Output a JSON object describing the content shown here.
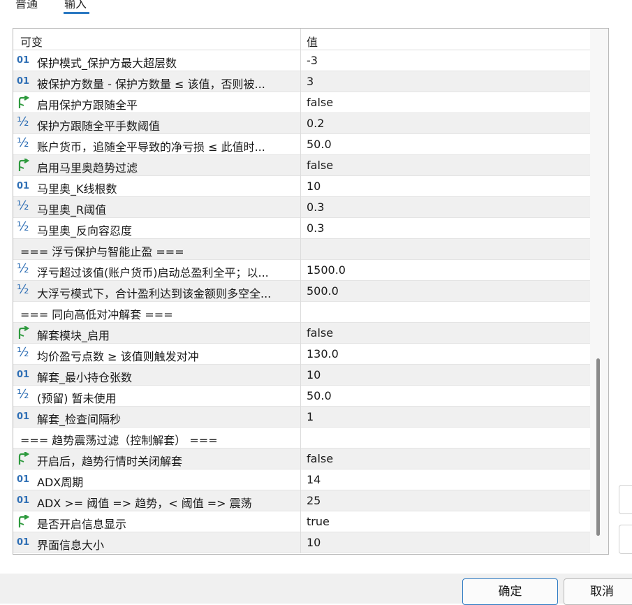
{
  "tabs": [
    {
      "label": "普通"
    },
    {
      "label": "输入"
    }
  ],
  "table": {
    "col_variable": "可变",
    "col_value": "值",
    "rows": [
      {
        "icon": "int",
        "icon_text": "01",
        "name": "保护模式_保护方最大超层数",
        "value": "-3"
      },
      {
        "icon": "int",
        "icon_text": "01",
        "name": "被保护方数量 - 保护方数量 ≤ 该值，否则被...",
        "value": "3"
      },
      {
        "icon": "bool",
        "name": "启用保护方跟随全平",
        "value": "false"
      },
      {
        "icon": "double",
        "icon_text": "½",
        "name": "保护方跟随全平手数阈值",
        "value": "0.2"
      },
      {
        "icon": "double",
        "icon_text": "½",
        "name": "账户货币，追随全平导致的净亏损 ≤ 此值时...",
        "value": "50.0"
      },
      {
        "icon": "bool",
        "name": "启用马里奥趋势过滤",
        "value": "false"
      },
      {
        "icon": "int",
        "icon_text": "01",
        "name": "马里奥_K线根数",
        "value": "10"
      },
      {
        "icon": "double",
        "icon_text": "½",
        "name": "马里奥_R阈值",
        "value": "0.3"
      },
      {
        "icon": "double",
        "icon_text": "½",
        "name": "马里奥_反向容忍度",
        "value": "0.3"
      },
      {
        "icon": "none",
        "name": "=== 浮亏保护与智能止盈 ===",
        "value": ""
      },
      {
        "icon": "double",
        "icon_text": "½",
        "name": "浮亏超过该值(账户货币)启动总盈利全平；以...",
        "value": "1500.0"
      },
      {
        "icon": "double",
        "icon_text": "½",
        "name": "大浮亏模式下，合计盈利达到该金额则多空全...",
        "value": "500.0"
      },
      {
        "icon": "none",
        "name": "=== 同向高低对冲解套 ===",
        "value": ""
      },
      {
        "icon": "bool",
        "name": "解套模块_启用",
        "value": "false"
      },
      {
        "icon": "double",
        "icon_text": "½",
        "name": "均价盈亏点数 ≥ 该值则触发对冲",
        "value": "130.0"
      },
      {
        "icon": "int",
        "icon_text": "01",
        "name": "解套_最小持仓张数",
        "value": "10"
      },
      {
        "icon": "double",
        "icon_text": "½",
        "name": "(预留) 暂未使用",
        "value": "50.0"
      },
      {
        "icon": "int",
        "icon_text": "01",
        "name": "解套_检查间隔秒",
        "value": "1"
      },
      {
        "icon": "none",
        "name": "=== 趋势震荡过滤（控制解套） ===",
        "value": ""
      },
      {
        "icon": "bool",
        "name": "开启后，趋势行情时关闭解套",
        "value": "false"
      },
      {
        "icon": "int",
        "icon_text": "01",
        "name": "ADX周期",
        "value": "14"
      },
      {
        "icon": "int",
        "icon_text": "01",
        "name": "ADX >= 阈值 => 趋势，< 阈值 => 震荡",
        "value": "25"
      },
      {
        "icon": "bool",
        "name": "是否开启信息显示",
        "value": "true"
      },
      {
        "icon": "int",
        "icon_text": "01",
        "name": "界面信息大小",
        "value": "10"
      }
    ]
  },
  "buttons": {
    "ok": "确定",
    "cancel": "取消"
  },
  "colors": {
    "int_icon": "#2f6fb5",
    "bool_icon": "#2e9a3e",
    "accent": "#2b79c2"
  }
}
